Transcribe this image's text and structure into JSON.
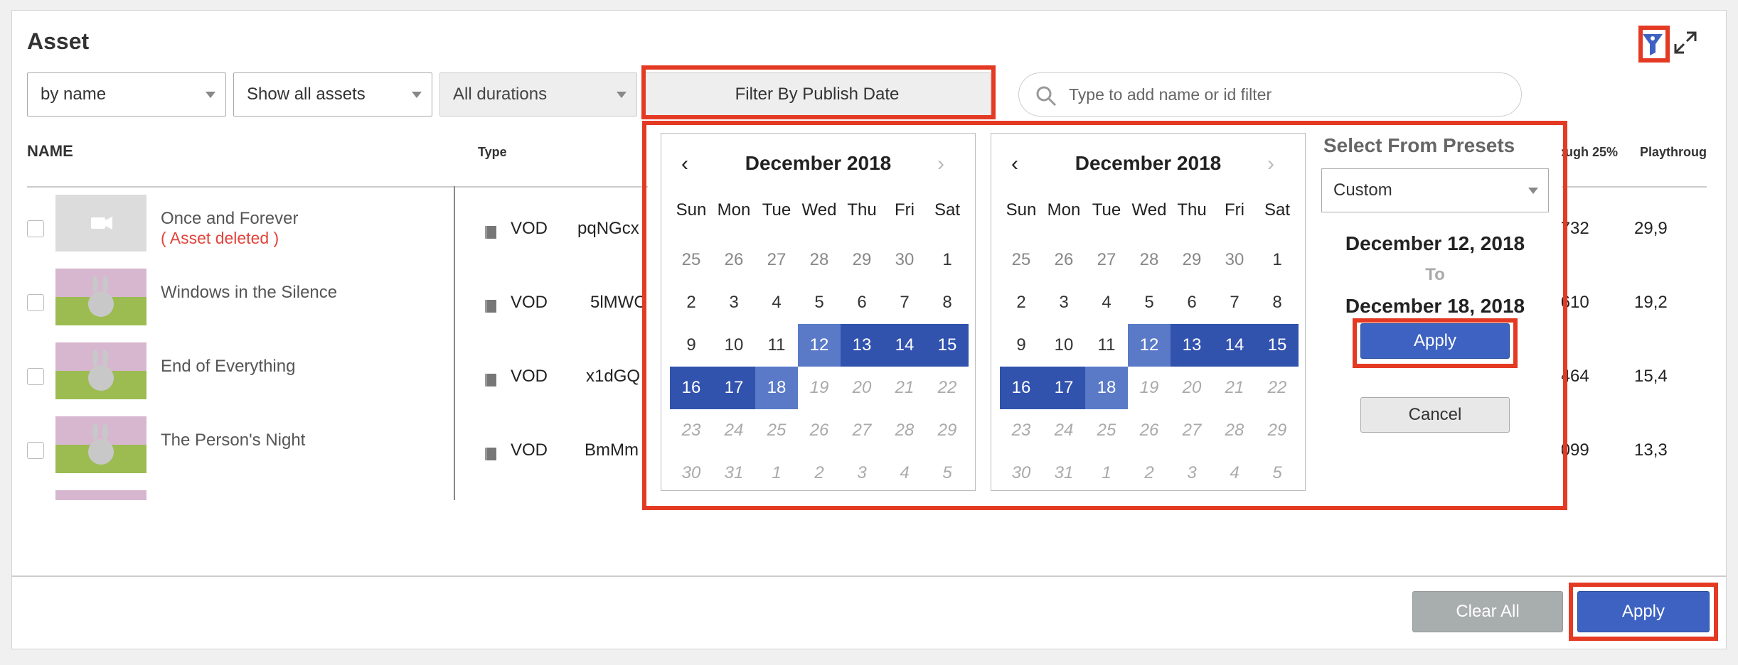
{
  "header": {
    "title": "Asset"
  },
  "filters": {
    "sort": "by name",
    "show": "Show all assets",
    "durations": "All durations",
    "publish_date_label": "Filter By Publish Date",
    "search_placeholder": "Type to add name or id filter"
  },
  "columns": {
    "name": "NAME",
    "type": "Type",
    "through25": "ough 25%",
    "playthrough": "Playthroug"
  },
  "assets": [
    {
      "name": "Once and Forever",
      "status": "( Asset deleted )",
      "type": "VOD",
      "id": "pqNGcx",
      "through25": ",732",
      "playthrough": "29,9"
    },
    {
      "name": "Windows in the Silence",
      "status": "",
      "type": "VOD",
      "id": "5lMWC",
      "through25": ",610",
      "playthrough": "19,2"
    },
    {
      "name": "End of Everything",
      "status": "",
      "type": "VOD",
      "id": "x1dGQ",
      "through25": ",464",
      "playthrough": "15,4"
    },
    {
      "name": "The Person's Night",
      "status": "",
      "type": "VOD",
      "id": "BmMm",
      "through25": ",099",
      "playthrough": "13,3"
    }
  ],
  "calendar": {
    "left_month": "December 2018",
    "right_month": "December 2018",
    "prev_icon": "‹",
    "next_icon": "›",
    "weekdays": [
      "Sun",
      "Mon",
      "Tue",
      "Wed",
      "Thu",
      "Fri",
      "Sat"
    ],
    "days": [
      "25",
      "26",
      "27",
      "28",
      "29",
      "30",
      "1",
      "2",
      "3",
      "4",
      "5",
      "6",
      "7",
      "8",
      "9",
      "10",
      "11",
      "12",
      "13",
      "14",
      "15",
      "16",
      "17",
      "18",
      "19",
      "20",
      "21",
      "22",
      "23",
      "24",
      "25",
      "26",
      "27",
      "28",
      "29",
      "30",
      "31",
      "1",
      "2",
      "3",
      "4",
      "5"
    ],
    "selected_range": [
      "12",
      "13",
      "14",
      "15",
      "16",
      "17",
      "18"
    ]
  },
  "presets": {
    "title": "Select From Presets",
    "value": "Custom",
    "from": "December 12, 2018",
    "to_label": "To",
    "to": "December 18, 2018",
    "apply": "Apply",
    "cancel": "Cancel"
  },
  "footer": {
    "clear_all": "Clear All",
    "apply": "Apply"
  },
  "icons": {
    "filter": "filter-icon",
    "expand": "expand-icon",
    "search": "search-icon",
    "camera": "video-camera-icon"
  },
  "colors": {
    "accent": "#3d62c1",
    "highlight": "#e43a24",
    "selected": "#3152ad",
    "deleted": "#e0443a"
  }
}
